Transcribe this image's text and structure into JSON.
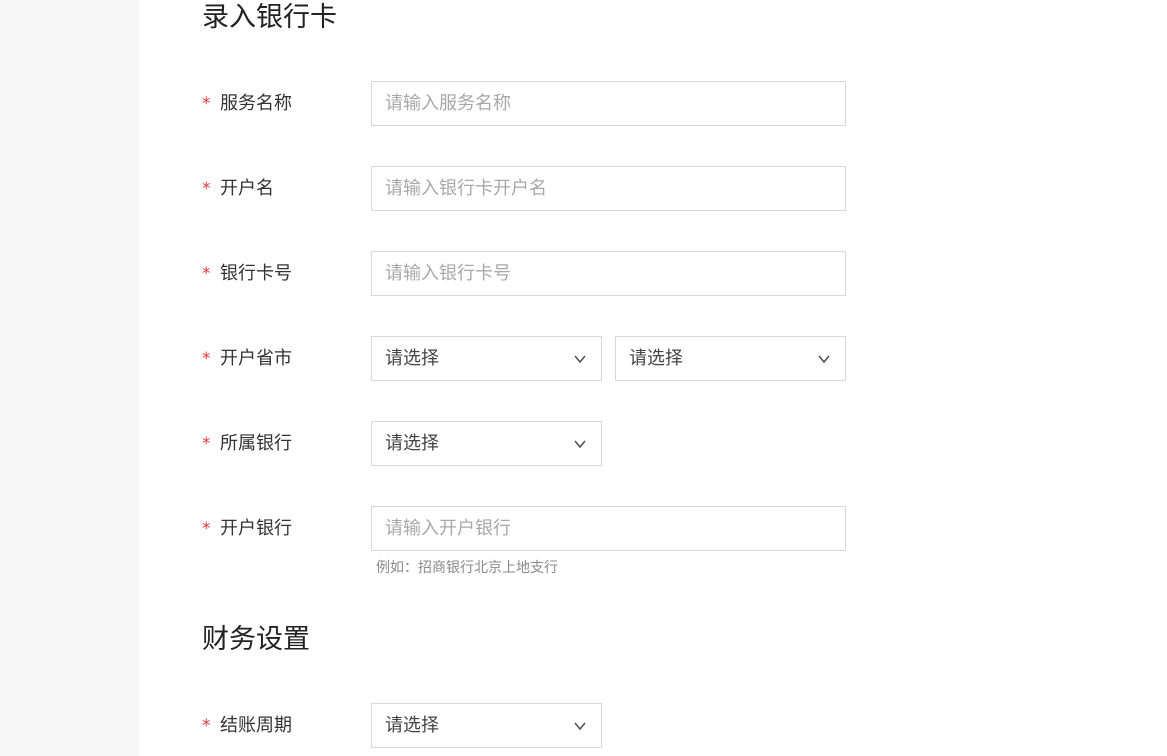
{
  "section1": {
    "title": "录入银行卡"
  },
  "fields": {
    "service_name": {
      "required_mark": "*",
      "label": "服务名称",
      "placeholder": "请输入服务名称"
    },
    "account_name": {
      "required_mark": "*",
      "label": "开户名",
      "placeholder": "请输入银行卡开户名"
    },
    "card_number": {
      "required_mark": "*",
      "label": "银行卡号",
      "placeholder": "请输入银行卡号"
    },
    "province_city": {
      "required_mark": "*",
      "label": "开户省市",
      "province_value": "请选择",
      "city_value": "请选择"
    },
    "bank": {
      "required_mark": "*",
      "label": "所属银行",
      "value": "请选择"
    },
    "branch": {
      "required_mark": "*",
      "label": "开户银行",
      "placeholder": "请输入开户银行",
      "hint": "例如：招商银行北京上地支行"
    }
  },
  "section2": {
    "title": "财务设置"
  },
  "finance": {
    "settlement_cycle": {
      "required_mark": "*",
      "label": "结账周期",
      "value": "请选择"
    }
  },
  "icons": {
    "dropdown": "chevron-down-icon"
  },
  "colors": {
    "required": "#e4393c",
    "border": "#d8d8d8",
    "placeholder": "#a8a8a8"
  }
}
